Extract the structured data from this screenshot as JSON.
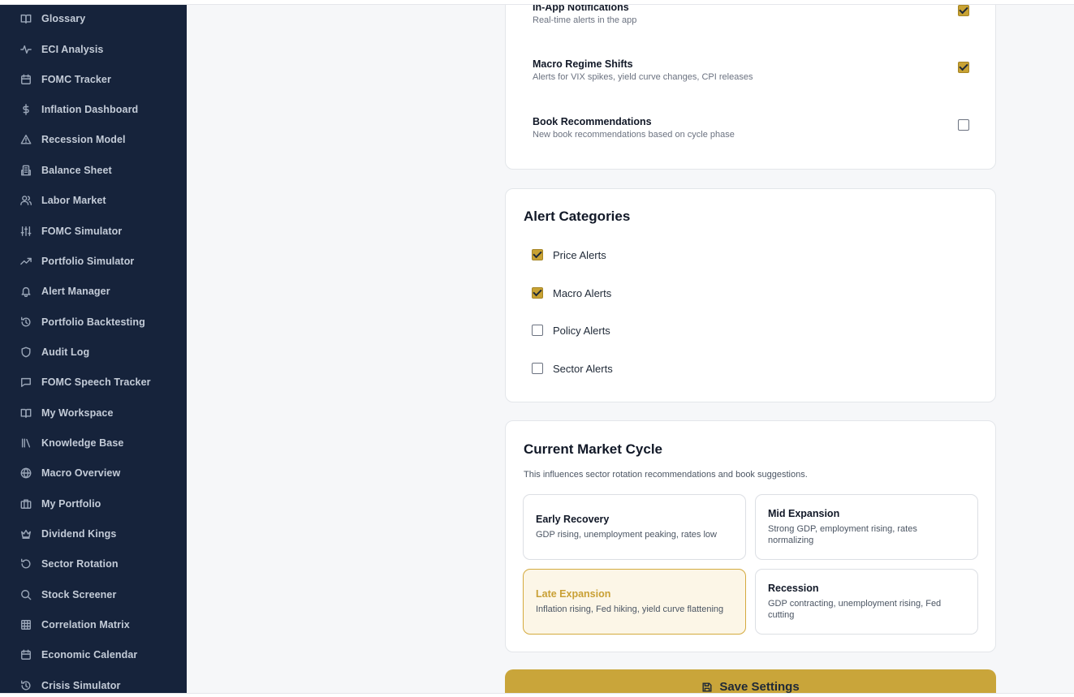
{
  "sidebar": {
    "items": [
      {
        "label": "Glossary",
        "icon": "book-open-icon"
      },
      {
        "label": "ECI Analysis",
        "icon": "activity-icon"
      },
      {
        "label": "FOMC Tracker",
        "icon": "calendar-icon"
      },
      {
        "label": "Inflation Dashboard",
        "icon": "dollar-icon"
      },
      {
        "label": "Recession Model",
        "icon": "warning-triangle-icon"
      },
      {
        "label": "Balance Sheet",
        "icon": "building-icon"
      },
      {
        "label": "Labor Market",
        "icon": "users-icon"
      },
      {
        "label": "FOMC Simulator",
        "icon": "sliders-icon"
      },
      {
        "label": "Portfolio Simulator",
        "icon": "trending-up-icon"
      },
      {
        "label": "Alert Manager",
        "icon": "bell-icon"
      },
      {
        "label": "Portfolio Backtesting",
        "icon": "history-icon"
      },
      {
        "label": "Audit Log",
        "icon": "shield-icon"
      },
      {
        "label": "FOMC Speech Tracker",
        "icon": "message-square-icon"
      },
      {
        "label": "My Workspace",
        "icon": "book-open-icon"
      },
      {
        "label": "Knowledge Base",
        "icon": "library-icon"
      },
      {
        "label": "Macro Overview",
        "icon": "globe-icon"
      },
      {
        "label": "My Portfolio",
        "icon": "briefcase-icon"
      },
      {
        "label": "Dividend Kings",
        "icon": "crown-icon"
      },
      {
        "label": "Sector Rotation",
        "icon": "rotate-ccw-icon"
      },
      {
        "label": "Stock Screener",
        "icon": "search-icon"
      },
      {
        "label": "Correlation Matrix",
        "icon": "grid-icon"
      },
      {
        "label": "Economic Calendar",
        "icon": "calendar-icon"
      },
      {
        "label": "Crisis Simulator",
        "icon": "history-icon"
      }
    ]
  },
  "notifications": {
    "items": [
      {
        "title": "In-App Notifications",
        "desc": "Real-time alerts in the app",
        "checked": true
      },
      {
        "title": "Macro Regime Shifts",
        "desc": "Alerts for VIX spikes, yield curve changes, CPI releases",
        "checked": true
      },
      {
        "title": "Book Recommendations",
        "desc": "New book recommendations based on cycle phase",
        "checked": false
      }
    ]
  },
  "alert_categories": {
    "title": "Alert Categories",
    "items": [
      {
        "label": "Price Alerts",
        "checked": true
      },
      {
        "label": "Macro Alerts",
        "checked": true
      },
      {
        "label": "Policy Alerts",
        "checked": false
      },
      {
        "label": "Sector Alerts",
        "checked": false
      }
    ]
  },
  "market_cycle": {
    "title": "Current Market Cycle",
    "description": "This influences sector rotation recommendations and book suggestions.",
    "phases": [
      {
        "name": "Early Recovery",
        "desc": "GDP rising, unemployment peaking, rates low",
        "selected": false
      },
      {
        "name": "Mid Expansion",
        "desc": "Strong GDP, employment rising, rates normalizing",
        "selected": false
      },
      {
        "name": "Late Expansion",
        "desc": "Inflation rising, Fed hiking, yield curve flattening",
        "selected": true
      },
      {
        "name": "Recession",
        "desc": "GDP contracting, unemployment rising, Fed cutting",
        "selected": false
      }
    ]
  },
  "save_button": {
    "label": "Save Settings",
    "icon": "save-icon"
  },
  "colors": {
    "sidebar_bg": "#16233b",
    "accent": "#c9a53a",
    "selected_bg": "#fcf6e7"
  }
}
